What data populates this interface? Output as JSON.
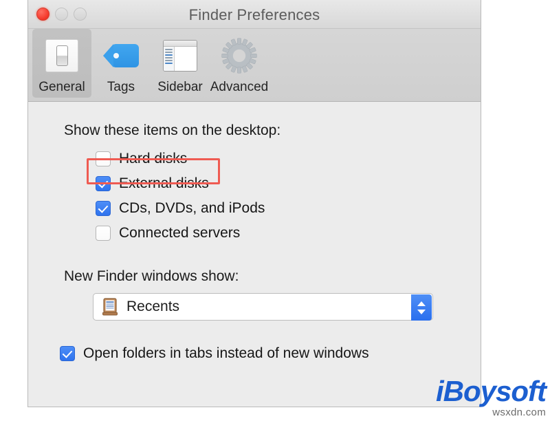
{
  "window": {
    "title": "Finder Preferences",
    "traffic_lights": [
      {
        "name": "close",
        "color": "#f4392c",
        "active": true
      },
      {
        "name": "minimize",
        "color": "#d4d4d4",
        "active": false
      },
      {
        "name": "zoom",
        "color": "#d4d4d4",
        "active": false
      }
    ]
  },
  "toolbar": {
    "tabs": [
      {
        "label": "General",
        "icon": "light-switch-icon",
        "selected": true
      },
      {
        "label": "Tags",
        "icon": "tag-icon",
        "selected": false
      },
      {
        "label": "Sidebar",
        "icon": "sidebar-window-icon",
        "selected": false
      },
      {
        "label": "Advanced",
        "icon": "gear-icon",
        "selected": false
      }
    ]
  },
  "general": {
    "desktop_section_label": "Show these items on the desktop:",
    "desktop_items": [
      {
        "label": "Hard disks",
        "checked": false
      },
      {
        "label": "External disks",
        "checked": true,
        "highlighted": true
      },
      {
        "label": "CDs, DVDs, and iPods",
        "checked": true
      },
      {
        "label": "Connected servers",
        "checked": false
      }
    ],
    "new_window_label": "New Finder windows show:",
    "new_window_value": "Recents",
    "new_window_icon": "recents-clock-icon",
    "open_folders_in_tabs": {
      "label": "Open folders in tabs instead of new windows",
      "checked": true
    }
  },
  "annotation": {
    "color": "#ef5b52",
    "target": "External disks"
  },
  "watermark": {
    "brand": "iBoysoft",
    "sub": "wsxdn.com",
    "color": "#1c5fd0"
  }
}
